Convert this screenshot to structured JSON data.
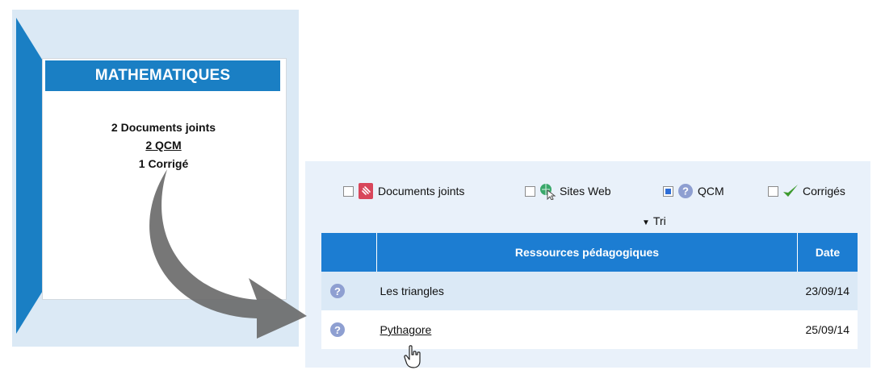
{
  "subject_card": {
    "title": "MATHEMATIQUES",
    "documents": "2 Documents joints",
    "qcm": "2 QCM",
    "corrige": "1 Corrigé"
  },
  "filters": [
    {
      "label": "Documents joints",
      "icon": "attachment-icon",
      "checked": false
    },
    {
      "label": "Sites Web",
      "icon": "globe-cursor-icon",
      "checked": false
    },
    {
      "label": "QCM",
      "icon": "question-icon",
      "checked": true
    },
    {
      "label": "Corrigés",
      "icon": "checkmark-icon",
      "checked": false
    }
  ],
  "sort": {
    "label": "Tri"
  },
  "table": {
    "columns": [
      "",
      "Ressources pédagogiques",
      "Date"
    ],
    "rows": [
      {
        "name": "Les triangles",
        "date": "23/09/14"
      },
      {
        "name": "Pythagore",
        "date": "25/09/14"
      }
    ]
  },
  "colors": {
    "brand_blue": "#1a7fc4",
    "header_blue": "#1c7dd2",
    "row_highlight": "#dbe9f6",
    "help_icon": "#8e9fd1"
  }
}
